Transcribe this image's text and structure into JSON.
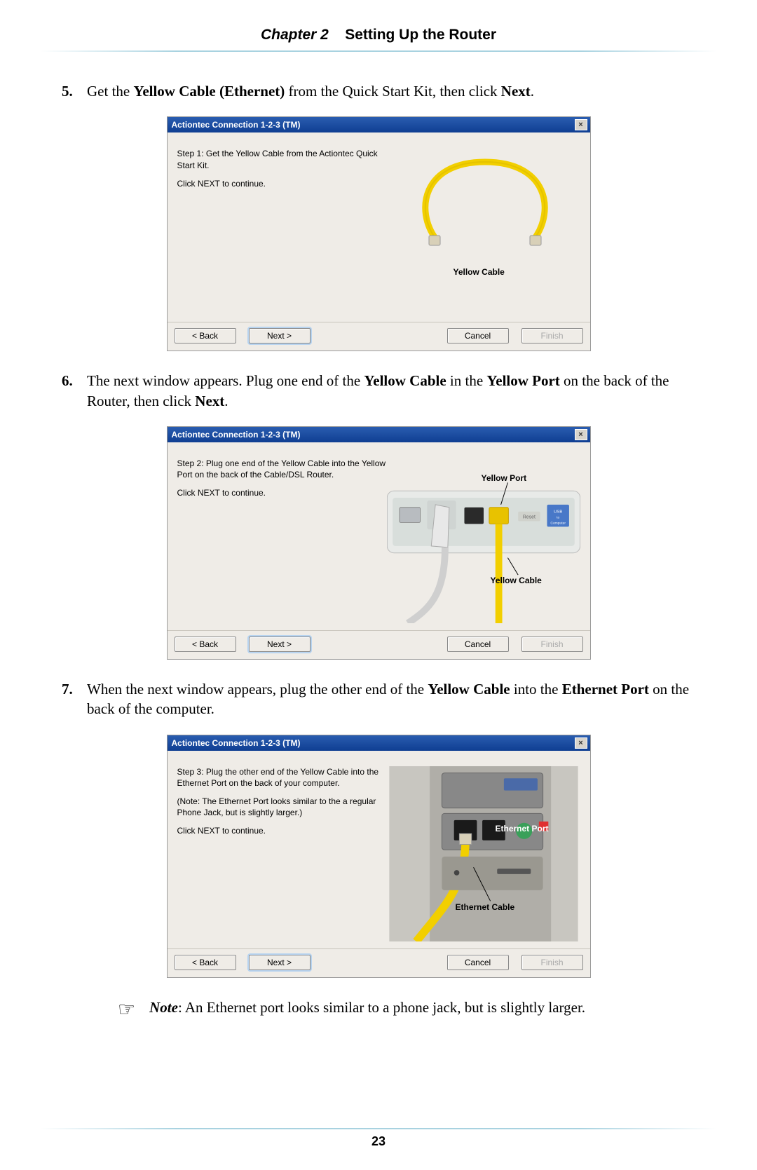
{
  "header": {
    "chapter_prefix": "Chapter 2",
    "chapter_title": "Setting Up the Router"
  },
  "steps": [
    {
      "number": "5.",
      "text_parts": [
        "Get the ",
        "Yellow Cable (Ethernet)",
        " from the Quick Start Kit, then click ",
        "Next",
        "."
      ],
      "dialog": {
        "title": "Actiontec Connection 1-2-3 (TM)",
        "body_lines": [
          "Step 1:  Get the Yellow Cable from the Actiontec Quick Start Kit.",
          "Click NEXT to continue."
        ],
        "image_labels": [
          {
            "text": "Yellow Cable",
            "style": "left:95px; top:170px;"
          }
        ],
        "cable_svg": true,
        "buttons": {
          "back": "< Back",
          "next": "Next >",
          "cancel": "Cancel",
          "finish": "Finish"
        }
      }
    },
    {
      "number": "6.",
      "text_parts": [
        "The next window appears. Plug one end of the ",
        "Yellow Cable",
        " in the ",
        "Yellow Port",
        " on the back of the Router, then click ",
        "Next",
        "."
      ],
      "dialog": {
        "title": "Actiontec Connection 1-2-3 (TM)",
        "body_lines": [
          "Step 2:  Plug one end of the Yellow Cable into the Yellow Port on the back of the Cable/DSL Router.",
          "Click NEXT to continue."
        ],
        "image_labels": [
          {
            "text": "Yellow Port",
            "style": "left:135px; top:22px;"
          },
          {
            "text": "Yellow Cable",
            "style": "left:148px; top:168px;"
          }
        ],
        "router_svg": true,
        "buttons": {
          "back": "< Back",
          "next": "Next >",
          "cancel": "Cancel",
          "finish": "Finish"
        }
      }
    },
    {
      "number": "7.",
      "text_parts": [
        "When the next window appears, plug the other end of the ",
        "Yellow Cable",
        " into the ",
        "Ethernet Port",
        " on the back of the computer."
      ],
      "dialog": {
        "title": "Actiontec Connection 1-2-3 (TM)",
        "body_lines": [
          "Step 3:  Plug the other end of the Yellow Cable into the Ethernet Port on the back of your computer.",
          "(Note:  The Ethernet Port looks similar to the a regular Phone Jack, but is slightly larger.)",
          "Click NEXT to continue."
        ],
        "image_labels": [
          {
            "text": "Ethernet Port",
            "style": "left:155px; top:82px; color:#fff;"
          },
          {
            "text": "Ethernet Cable",
            "style": "left:98px; top:194px;"
          }
        ],
        "pc_svg": true,
        "buttons": {
          "back": "< Back",
          "next": "Next >",
          "cancel": "Cancel",
          "finish": "Finish"
        }
      }
    }
  ],
  "note": {
    "prefix": "Note",
    "text": ": An Ethernet port looks similar to a phone jack, but is slightly larger."
  },
  "page_number": "23"
}
